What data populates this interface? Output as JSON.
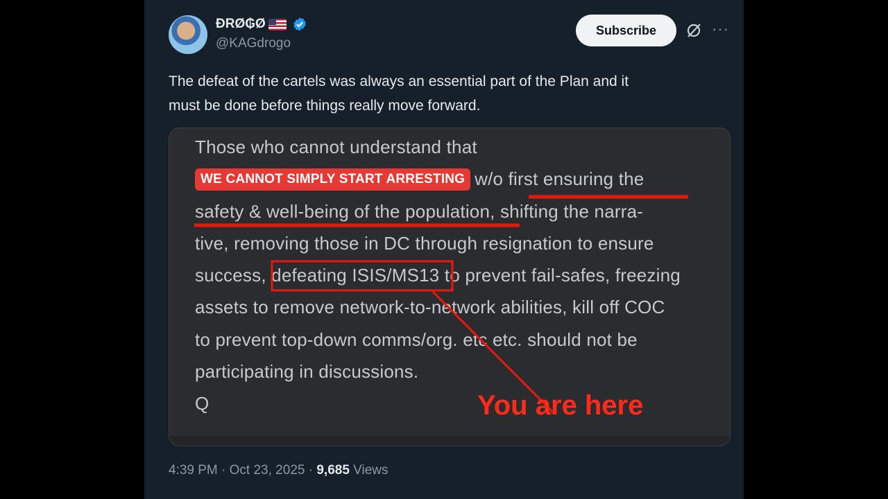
{
  "author": {
    "name": "ÐRØ₲Ø",
    "handle": "@KAGdrogo"
  },
  "header": {
    "subscribe_label": "Subscribe"
  },
  "icons": [
    "avatar",
    "us-flag-icon",
    "verified-badge-icon",
    "grok-icon",
    "more-icon"
  ],
  "tweet": {
    "text_line1": "The defeat of the cartels was always an essential part of the Plan and it",
    "text_line2": "must be done before things really move forward."
  },
  "media": {
    "line1": "Those who cannot understand that",
    "badge": "WE CANNOT SIMPLY START ARRESTING",
    "line2_rest": "w/o first ensuring the",
    "line3a": "safety & well-being of the population",
    "line3b": ", shifting the narra-",
    "line4": "tive, removing those in DC through resignation to ensure",
    "line5a": "success, ",
    "line5b": "defeating ISIS/MS13",
    "line5c": " to prevent fail-safes, freezing",
    "line6": "assets to remove network-to-network abilities, kill off COC",
    "line7": "to prevent top-down comms/org. etc etc. should not be",
    "line8": "participating in discussions.",
    "line9": "Q",
    "annotation": "You are here"
  },
  "meta": {
    "time": "4:39 PM",
    "date": "Oct 23, 2025",
    "separator": "·",
    "views_count": "9,685",
    "views_label": "Views"
  },
  "colors": {
    "background": "#15202b",
    "accent_red": "#ff2a1a",
    "verified_blue": "#1d9bf0"
  }
}
